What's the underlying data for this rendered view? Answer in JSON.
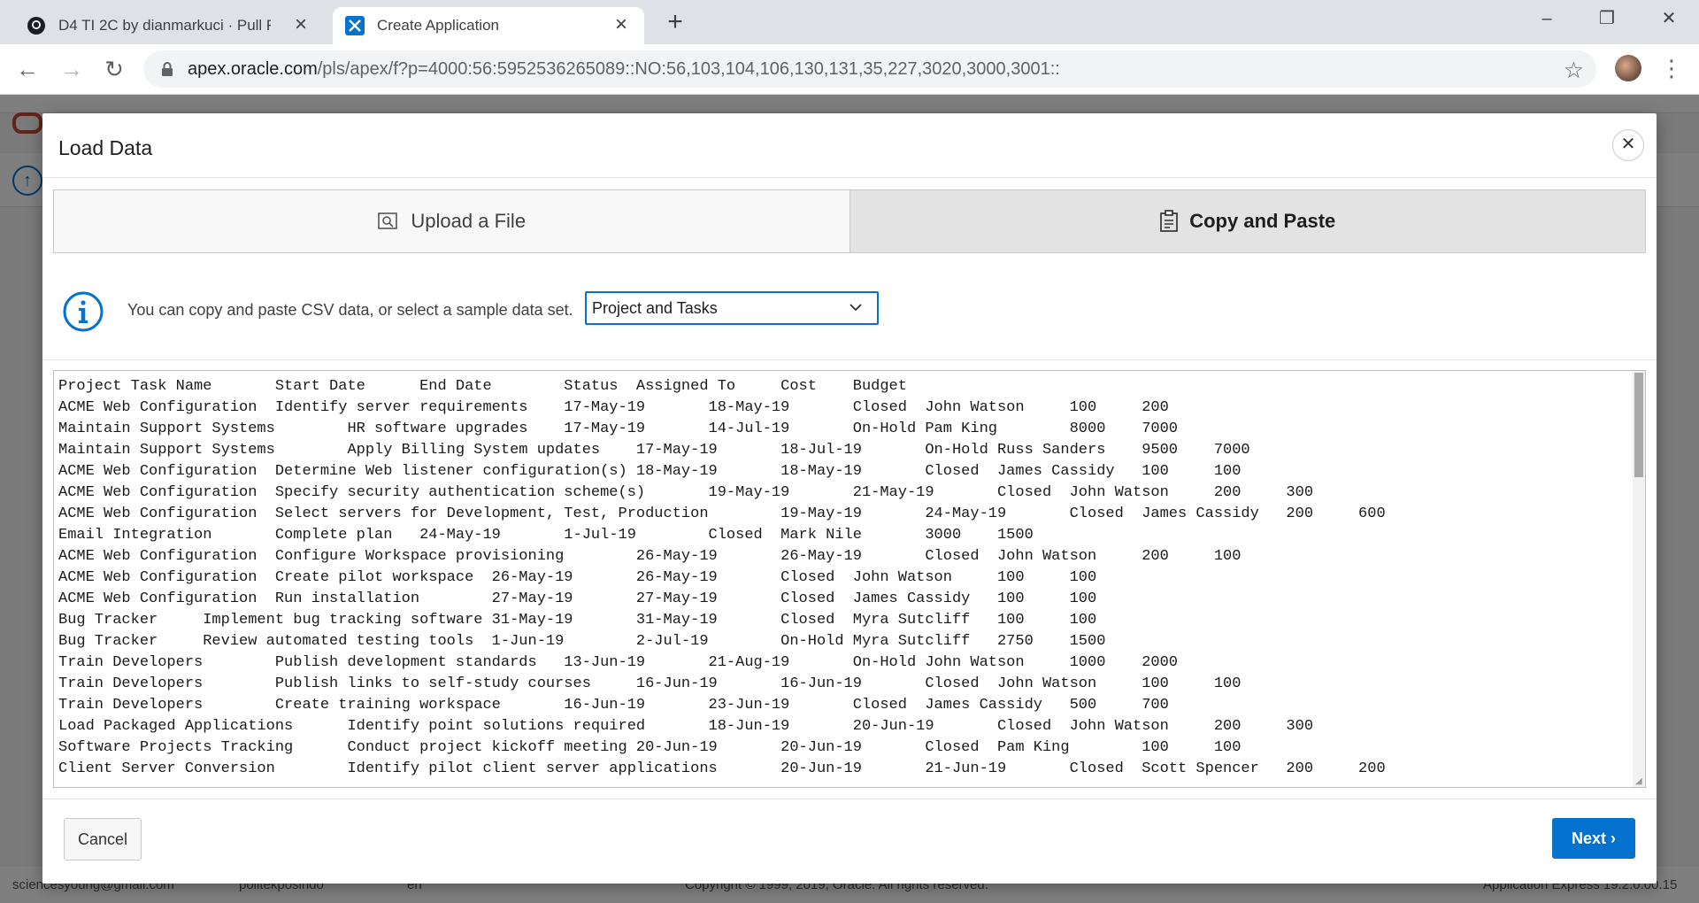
{
  "browser": {
    "tabs": [
      {
        "title": "D4 TI 2C by dianmarkuci · Pull Re"
      },
      {
        "title": "Create Application"
      }
    ],
    "url_host": "apex.oracle.com",
    "url_path": "/pls/apex/f?p=4000:56:5952536265089::NO:56,103,104,106,130,131,35,227,3020,3000,3001::"
  },
  "footer": {
    "user": "sciencesyoung@gmail.com",
    "workspace": "politekposindo",
    "language": "en",
    "copyright": "Copyright © 1999, 2019, Oracle. All rights reserved.",
    "version": "Application Express 19.2.0.00.15"
  },
  "dialog": {
    "title": "Load Data",
    "segments": {
      "upload": "Upload a File",
      "paste": "Copy and Paste"
    },
    "info_text": "You can copy and paste CSV data, or select a sample data set.",
    "sample_select": "Project and Tasks",
    "csv_lines": "Project Task Name       Start Date      End Date        Status  Assigned To     Cost    Budget\nACME Web Configuration  Identify server requirements    17-May-19       18-May-19       Closed  John Watson     100     200\nMaintain Support Systems        HR software upgrades    17-May-19       14-Jul-19       On-Hold Pam King        8000    7000\nMaintain Support Systems        Apply Billing System updates    17-May-19       18-Jul-19       On-Hold Russ Sanders    9500    7000\nACME Web Configuration  Determine Web listener configuration(s) 18-May-19       18-May-19       Closed  James Cassidy   100     100\nACME Web Configuration  Specify security authentication scheme(s)       19-May-19       21-May-19       Closed  John Watson     200     300\nACME Web Configuration  Select servers for Development, Test, Production        19-May-19       24-May-19       Closed  James Cassidy   200     600\nEmail Integration       Complete plan   24-May-19       1-Jul-19        Closed  Mark Nile       3000    1500\nACME Web Configuration  Configure Workspace provisioning        26-May-19       26-May-19       Closed  John Watson     200     100\nACME Web Configuration  Create pilot workspace  26-May-19       26-May-19       Closed  John Watson     100     100\nACME Web Configuration  Run installation        27-May-19       27-May-19       Closed  James Cassidy   100     100\nBug Tracker     Implement bug tracking software 31-May-19       31-May-19       Closed  Myra Sutcliff   100     100\nBug Tracker     Review automated testing tools  1-Jun-19        2-Jul-19        On-Hold Myra Sutcliff   2750    1500\nTrain Developers        Publish development standards   13-Jun-19       21-Aug-19       On-Hold John Watson     1000    2000\nTrain Developers        Publish links to self-study courses     16-Jun-19       16-Jun-19       Closed  John Watson     100     100\nTrain Developers        Create training workspace       16-Jun-19       23-Jun-19       Closed  James Cassidy   500     700\nLoad Packaged Applications      Identify point solutions required       18-Jun-19       20-Jun-19       Closed  John Watson     200     300\nSoftware Projects Tracking      Conduct project kickoff meeting 20-Jun-19       20-Jun-19       Closed  Pam King        100     100\nClient Server Conversion        Identify pilot client server applications       20-Jun-19       21-Jun-19       Closed  Scott Spencer   200     200",
    "cancel": "Cancel",
    "next": "Next"
  },
  "colors": {
    "accent": "#0572ce",
    "oracle_red": "#c74634"
  }
}
